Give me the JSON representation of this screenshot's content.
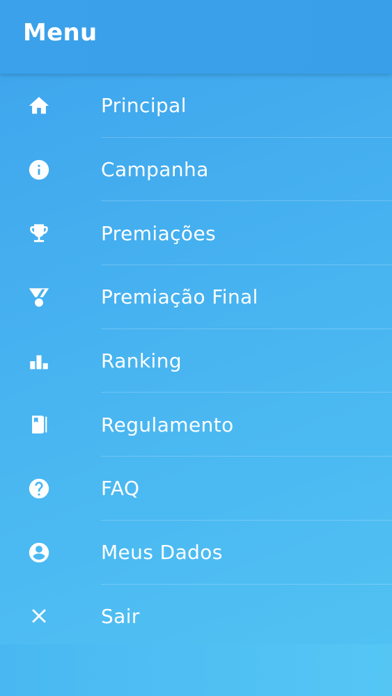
{
  "header": {
    "title": "Menu"
  },
  "menu": {
    "items": [
      {
        "label": "Principal",
        "icon": "home-icon"
      },
      {
        "label": "Campanha",
        "icon": "info-icon"
      },
      {
        "label": "Premiações",
        "icon": "trophy-icon"
      },
      {
        "label": "Premiação Final",
        "icon": "medal-icon"
      },
      {
        "label": "Ranking",
        "icon": "ranking-icon"
      },
      {
        "label": "Regulamento",
        "icon": "book-icon"
      },
      {
        "label": "FAQ",
        "icon": "help-icon"
      },
      {
        "label": "Meus Dados",
        "icon": "account-icon"
      },
      {
        "label": "Sair",
        "icon": "close-icon"
      }
    ]
  },
  "colors": {
    "header": "#3aa1ea",
    "background": "#48b3f0",
    "text": "#ffffff"
  }
}
